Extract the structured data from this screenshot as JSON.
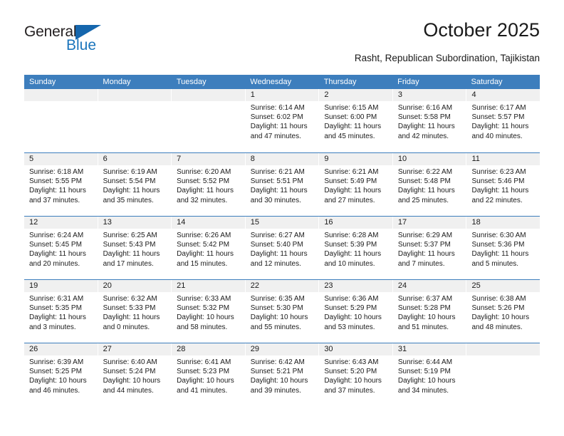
{
  "brand": {
    "name_part1": "General",
    "name_part2": "Blue",
    "triangle_icon": "triangle-icon",
    "accent_color": "#1b75bc"
  },
  "header": {
    "title": "October 2025",
    "subtitle": "Rasht, Republican Subordination, Tajikistan"
  },
  "calendar": {
    "header_color": "#3d7ebd",
    "weekdays": [
      "Sunday",
      "Monday",
      "Tuesday",
      "Wednesday",
      "Thursday",
      "Friday",
      "Saturday"
    ],
    "weeks": [
      [
        {
          "day": "",
          "empty": true
        },
        {
          "day": "",
          "empty": true
        },
        {
          "day": "",
          "empty": true
        },
        {
          "day": "1",
          "sunrise": "Sunrise: 6:14 AM",
          "sunset": "Sunset: 6:02 PM",
          "daylight": "Daylight: 11 hours and 47 minutes."
        },
        {
          "day": "2",
          "sunrise": "Sunrise: 6:15 AM",
          "sunset": "Sunset: 6:00 PM",
          "daylight": "Daylight: 11 hours and 45 minutes."
        },
        {
          "day": "3",
          "sunrise": "Sunrise: 6:16 AM",
          "sunset": "Sunset: 5:58 PM",
          "daylight": "Daylight: 11 hours and 42 minutes."
        },
        {
          "day": "4",
          "sunrise": "Sunrise: 6:17 AM",
          "sunset": "Sunset: 5:57 PM",
          "daylight": "Daylight: 11 hours and 40 minutes."
        }
      ],
      [
        {
          "day": "5",
          "sunrise": "Sunrise: 6:18 AM",
          "sunset": "Sunset: 5:55 PM",
          "daylight": "Daylight: 11 hours and 37 minutes."
        },
        {
          "day": "6",
          "sunrise": "Sunrise: 6:19 AM",
          "sunset": "Sunset: 5:54 PM",
          "daylight": "Daylight: 11 hours and 35 minutes."
        },
        {
          "day": "7",
          "sunrise": "Sunrise: 6:20 AM",
          "sunset": "Sunset: 5:52 PM",
          "daylight": "Daylight: 11 hours and 32 minutes."
        },
        {
          "day": "8",
          "sunrise": "Sunrise: 6:21 AM",
          "sunset": "Sunset: 5:51 PM",
          "daylight": "Daylight: 11 hours and 30 minutes."
        },
        {
          "day": "9",
          "sunrise": "Sunrise: 6:21 AM",
          "sunset": "Sunset: 5:49 PM",
          "daylight": "Daylight: 11 hours and 27 minutes."
        },
        {
          "day": "10",
          "sunrise": "Sunrise: 6:22 AM",
          "sunset": "Sunset: 5:48 PM",
          "daylight": "Daylight: 11 hours and 25 minutes."
        },
        {
          "day": "11",
          "sunrise": "Sunrise: 6:23 AM",
          "sunset": "Sunset: 5:46 PM",
          "daylight": "Daylight: 11 hours and 22 minutes."
        }
      ],
      [
        {
          "day": "12",
          "sunrise": "Sunrise: 6:24 AM",
          "sunset": "Sunset: 5:45 PM",
          "daylight": "Daylight: 11 hours and 20 minutes."
        },
        {
          "day": "13",
          "sunrise": "Sunrise: 6:25 AM",
          "sunset": "Sunset: 5:43 PM",
          "daylight": "Daylight: 11 hours and 17 minutes."
        },
        {
          "day": "14",
          "sunrise": "Sunrise: 6:26 AM",
          "sunset": "Sunset: 5:42 PM",
          "daylight": "Daylight: 11 hours and 15 minutes."
        },
        {
          "day": "15",
          "sunrise": "Sunrise: 6:27 AM",
          "sunset": "Sunset: 5:40 PM",
          "daylight": "Daylight: 11 hours and 12 minutes."
        },
        {
          "day": "16",
          "sunrise": "Sunrise: 6:28 AM",
          "sunset": "Sunset: 5:39 PM",
          "daylight": "Daylight: 11 hours and 10 minutes."
        },
        {
          "day": "17",
          "sunrise": "Sunrise: 6:29 AM",
          "sunset": "Sunset: 5:37 PM",
          "daylight": "Daylight: 11 hours and 7 minutes."
        },
        {
          "day": "18",
          "sunrise": "Sunrise: 6:30 AM",
          "sunset": "Sunset: 5:36 PM",
          "daylight": "Daylight: 11 hours and 5 minutes."
        }
      ],
      [
        {
          "day": "19",
          "sunrise": "Sunrise: 6:31 AM",
          "sunset": "Sunset: 5:35 PM",
          "daylight": "Daylight: 11 hours and 3 minutes."
        },
        {
          "day": "20",
          "sunrise": "Sunrise: 6:32 AM",
          "sunset": "Sunset: 5:33 PM",
          "daylight": "Daylight: 11 hours and 0 minutes."
        },
        {
          "day": "21",
          "sunrise": "Sunrise: 6:33 AM",
          "sunset": "Sunset: 5:32 PM",
          "daylight": "Daylight: 10 hours and 58 minutes."
        },
        {
          "day": "22",
          "sunrise": "Sunrise: 6:35 AM",
          "sunset": "Sunset: 5:30 PM",
          "daylight": "Daylight: 10 hours and 55 minutes."
        },
        {
          "day": "23",
          "sunrise": "Sunrise: 6:36 AM",
          "sunset": "Sunset: 5:29 PM",
          "daylight": "Daylight: 10 hours and 53 minutes."
        },
        {
          "day": "24",
          "sunrise": "Sunrise: 6:37 AM",
          "sunset": "Sunset: 5:28 PM",
          "daylight": "Daylight: 10 hours and 51 minutes."
        },
        {
          "day": "25",
          "sunrise": "Sunrise: 6:38 AM",
          "sunset": "Sunset: 5:26 PM",
          "daylight": "Daylight: 10 hours and 48 minutes."
        }
      ],
      [
        {
          "day": "26",
          "sunrise": "Sunrise: 6:39 AM",
          "sunset": "Sunset: 5:25 PM",
          "daylight": "Daylight: 10 hours and 46 minutes."
        },
        {
          "day": "27",
          "sunrise": "Sunrise: 6:40 AM",
          "sunset": "Sunset: 5:24 PM",
          "daylight": "Daylight: 10 hours and 44 minutes."
        },
        {
          "day": "28",
          "sunrise": "Sunrise: 6:41 AM",
          "sunset": "Sunset: 5:23 PM",
          "daylight": "Daylight: 10 hours and 41 minutes."
        },
        {
          "day": "29",
          "sunrise": "Sunrise: 6:42 AM",
          "sunset": "Sunset: 5:21 PM",
          "daylight": "Daylight: 10 hours and 39 minutes."
        },
        {
          "day": "30",
          "sunrise": "Sunrise: 6:43 AM",
          "sunset": "Sunset: 5:20 PM",
          "daylight": "Daylight: 10 hours and 37 minutes."
        },
        {
          "day": "31",
          "sunrise": "Sunrise: 6:44 AM",
          "sunset": "Sunset: 5:19 PM",
          "daylight": "Daylight: 10 hours and 34 minutes."
        },
        {
          "day": "",
          "empty": true
        }
      ]
    ]
  }
}
